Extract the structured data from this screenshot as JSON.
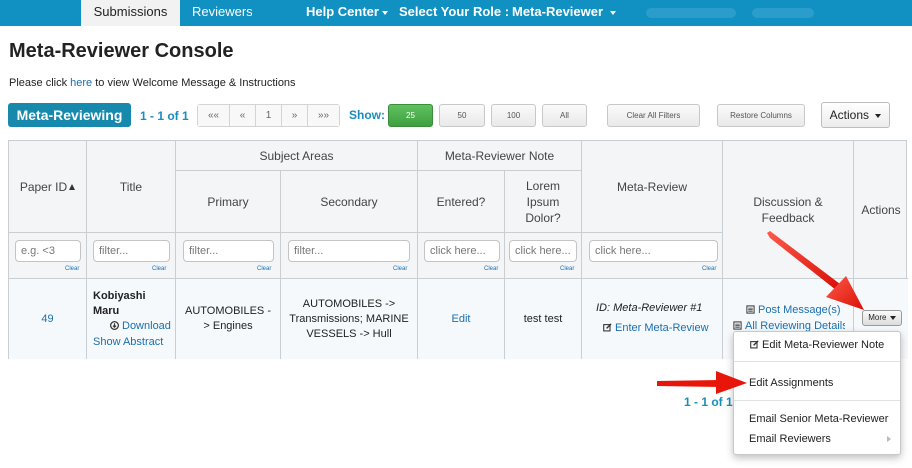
{
  "nav": {
    "tabs": [
      "Submissions",
      "Reviewers"
    ],
    "help_center": "Help Center",
    "role_label": "Select Your Role :",
    "role_value": "Meta-Reviewer"
  },
  "page": {
    "title": "Meta-Reviewer Console",
    "intro_before": "Please click ",
    "intro_link": "here",
    "intro_after": " to view Welcome Message & Instructions"
  },
  "toolbar": {
    "badge": "Meta-Reviewing",
    "range": "1 - 1 of 1",
    "pager": [
      "««",
      "«",
      "1",
      "»",
      "»»"
    ],
    "show_label": "Show:",
    "page_sizes": [
      "25",
      "50",
      "100",
      "All"
    ],
    "clear_filters": "Clear All Filters",
    "restore_columns": "Restore Columns",
    "actions": "Actions"
  },
  "table": {
    "headers": {
      "paper_id": "Paper ID",
      "title": "Title",
      "subject_areas": "Subject Areas",
      "primary": "Primary",
      "secondary": "Secondary",
      "mr_note": "Meta-Reviewer Note",
      "entered": "Entered?",
      "lorem": "Lorem Ipsum Dolor?",
      "meta_review": "Meta-Review",
      "discussion": "Discussion & Feedback",
      "actions": "Actions"
    },
    "filters": {
      "paper_id": "e.g. <3",
      "generic": "filter...",
      "click": "click here...",
      "clear": "Clear"
    },
    "row": {
      "paper_id": "49",
      "title": "Kobiyashi Maru",
      "download": "Download",
      "show_abstract": "Show Abstract",
      "primary": "AUTOMOBILES -> Engines",
      "secondary": "AUTOMOBILES -> Transmissions; MARINE VESSELS -> Hull",
      "entered": "Edit",
      "lorem": "test test",
      "meta_review_id": "ID: Meta-Reviewer #1",
      "enter_meta_review": "Enter Meta-Review",
      "post_message": "Post Message(s)",
      "all_reviewing_details": "All Reviewing Details",
      "more": "More"
    }
  },
  "pager_bottom": "1 - 1 of 1",
  "menu": {
    "edit_note": "Edit Meta-Reviewer Note",
    "edit_assignments": "Edit Assignments",
    "email_senior": "Email Senior Meta-Reviewer",
    "email_reviewers": "Email Reviewers"
  },
  "colors": {
    "nav": "#1190c2",
    "accent": "#1789ad",
    "link": "#1a6fb0",
    "highlight": "#ffff00",
    "arrow": "#e8150b"
  }
}
